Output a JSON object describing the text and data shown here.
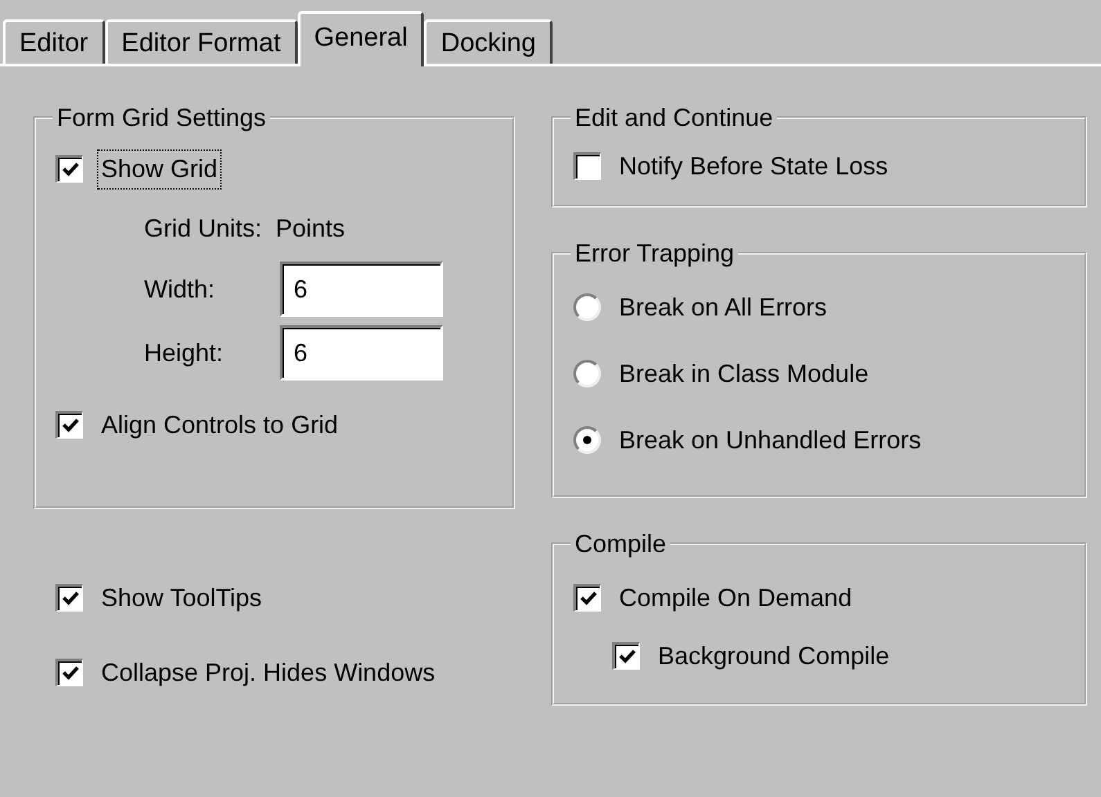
{
  "tabs": [
    {
      "label": "Editor",
      "selected": false
    },
    {
      "label": "Editor Format",
      "selected": false
    },
    {
      "label": "General",
      "selected": true
    },
    {
      "label": "Docking",
      "selected": false
    }
  ],
  "form_grid_settings": {
    "title": "Form Grid Settings",
    "show_grid": {
      "label": "Show Grid",
      "checked": true,
      "focused": true
    },
    "grid_units_label": "Grid Units:",
    "grid_units_value": "Points",
    "fields": [
      {
        "label": "Width:",
        "value": "6"
      },
      {
        "label": "Height:",
        "value": "6"
      }
    ],
    "align_controls": {
      "label": "Align Controls to Grid",
      "checked": true,
      "focused": false
    }
  },
  "options": [
    {
      "label": "Show ToolTips",
      "checked": true
    },
    {
      "label": "Collapse Proj. Hides Windows",
      "checked": true
    }
  ],
  "edit_and_continue": {
    "title": "Edit and Continue",
    "options": [
      {
        "label": "Notify Before State Loss",
        "checked": false
      }
    ]
  },
  "error_trapping": {
    "title": "Error Trapping",
    "options": [
      {
        "label": "Break on All Errors",
        "selected": false
      },
      {
        "label": "Break in Class Module",
        "selected": false
      },
      {
        "label": "Break on Unhandled Errors",
        "selected": true
      }
    ]
  },
  "compile": {
    "title": "Compile",
    "options": [
      {
        "label": "Compile On Demand",
        "checked": true,
        "children": [
          {
            "label": "Background Compile",
            "checked": true
          }
        ]
      }
    ]
  }
}
